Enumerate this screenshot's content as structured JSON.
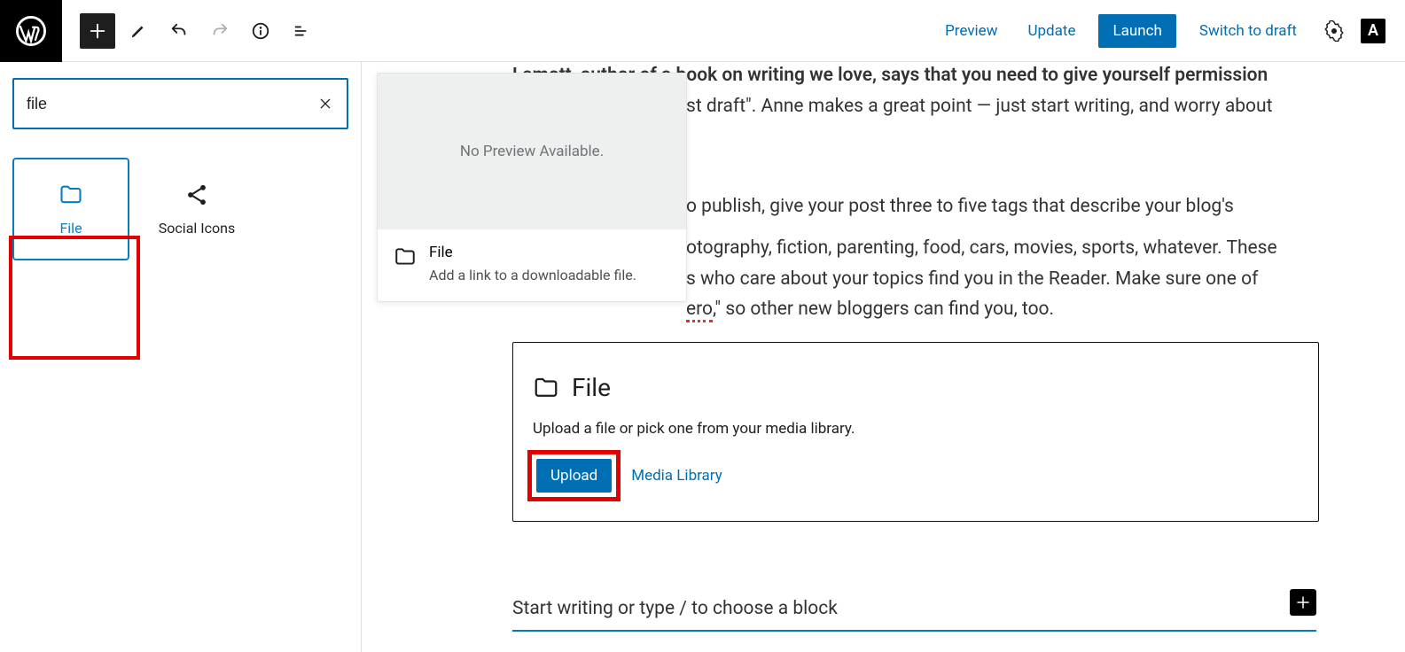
{
  "toolbar": {
    "preview": "Preview",
    "update": "Update",
    "launch": "Launch",
    "switch_draft": "Switch to draft",
    "jp": "A"
  },
  "inserter": {
    "search_value": "file",
    "blocks": [
      {
        "label": "File"
      },
      {
        "label": "Social Icons"
      }
    ]
  },
  "preview_popover": {
    "no_preview": "No Preview Available.",
    "title": "File",
    "description": "Add a link to a downloadable file."
  },
  "content": {
    "p1a": "Lamott, author of a book on writing we love, says that you need to give yourself permission",
    "p1b": "st draft\". Anne makes a great point — just start writing, and worry about",
    "p2a": "o publish, give your post three to five tags that describe your blog's",
    "p2b": "otography, fiction, parenting, food, cars, movies, sports, whatever. These",
    "p2c": "s who care about your topics find you in the Reader. Make sure one of",
    "p2d_pre": "",
    "p2d_mis": "ero",
    "p2d_post": ",\" so other new bloggers can find you, too.",
    "placeholder": "Start writing or type / to choose a block"
  },
  "file_block": {
    "title": "File",
    "hint": "Upload a file or pick one from your media library.",
    "upload": "Upload",
    "media_library": "Media Library"
  }
}
